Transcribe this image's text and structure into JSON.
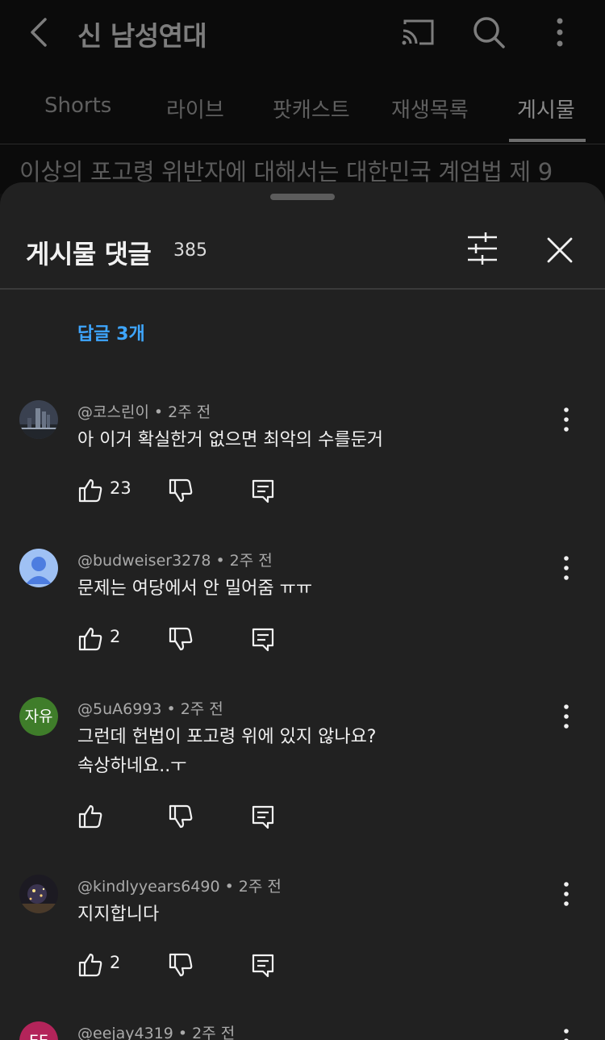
{
  "header": {
    "title": "신 남성연대"
  },
  "tabs": [
    {
      "label": "Shorts"
    },
    {
      "label": "라이브"
    },
    {
      "label": "팟캐스트"
    },
    {
      "label": "재생목록"
    },
    {
      "label": "게시물",
      "active": true
    }
  ],
  "post_preview": "이상의 포고령 위반자에 대해서는 대한민국 계엄법 제 9",
  "sheet": {
    "title": "게시물 댓글",
    "count": "385",
    "replies_link": "답글 3개"
  },
  "comments": [
    {
      "author": "@코스린이",
      "time": "2주 전",
      "lines": [
        "아 이거 확실한거 없으면 최악의 수를둔거"
      ],
      "likes": "23",
      "avatar_icon": "city-night-photo-avatar"
    },
    {
      "author": "@budweiser3278",
      "time": "2주 전",
      "lines": [
        "문제는 여당에서 안 밀어줌 ㅠㅠ"
      ],
      "likes": "2",
      "avatar_icon": "default-person-avatar"
    },
    {
      "author": "@5uA6993",
      "time": "2주 전",
      "lines": [
        "그런데 헌법이 포고령 위에 있지 않나요?",
        "속상하네요..ㅜ"
      ],
      "likes": "",
      "avatar_text": "자유"
    },
    {
      "author": "@kindlyyears6490",
      "time": "2주 전",
      "lines": [
        "지지합니다"
      ],
      "likes": "2",
      "avatar_icon": "night-lights-photo-avatar"
    },
    {
      "author": "@eejay4319",
      "time": "2주 전",
      "lines": [],
      "likes": "",
      "avatar_text": "EE"
    }
  ],
  "colors": {
    "link": "#3ea6ff",
    "sheet_bg": "#212121",
    "avatar_green": "#3f7d2a",
    "avatar_blue": "#9fc1f4",
    "avatar_pink": "#b3245a"
  }
}
